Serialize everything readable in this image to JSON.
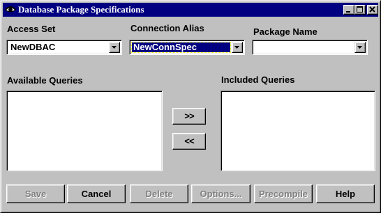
{
  "window": {
    "title": "Database Package Specifications",
    "icon": "eye-icon",
    "controls": [
      "minimize-icon",
      "maximize-icon",
      "close-icon"
    ]
  },
  "fields": {
    "access_set": {
      "label": "Access Set",
      "value": "NewDBAC"
    },
    "connection_alias": {
      "label": "Connection Alias",
      "value": "NewConnSpec",
      "focused": true
    },
    "package_name": {
      "label": "Package Name",
      "value": ""
    }
  },
  "lists": {
    "available": {
      "label": "Available Queries",
      "items": []
    },
    "included": {
      "label": "Included Queries",
      "items": []
    }
  },
  "move_buttons": {
    "add": ">>",
    "remove": "<<"
  },
  "buttons": {
    "save": {
      "label": "Save",
      "enabled": false
    },
    "cancel": {
      "label": "Cancel",
      "enabled": true
    },
    "delete": {
      "label": "Delete",
      "enabled": false
    },
    "options": {
      "label": "Options...",
      "enabled": false
    },
    "precompile": {
      "label": "Precompile",
      "enabled": false
    },
    "help": {
      "label": "Help",
      "enabled": true
    }
  },
  "colors": {
    "face": "#c0c0c0",
    "titlebar": "#000080",
    "selection": "#000080",
    "disabled_text": "#808080"
  }
}
